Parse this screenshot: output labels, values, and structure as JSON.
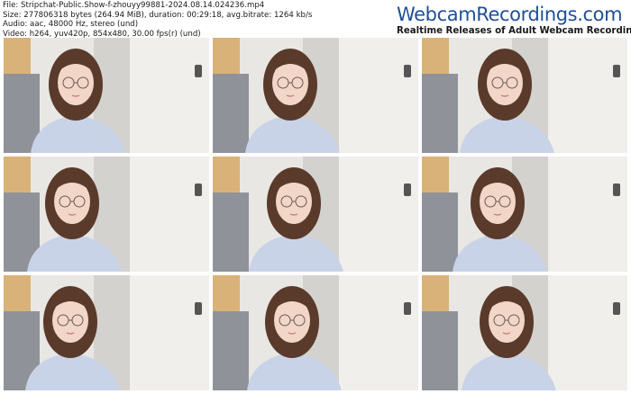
{
  "file_info": {
    "file": "File: Stripchat-Public.Show-f-zhouyy99881-2024.08.14.024236.mp4",
    "size": "Size: 277806318 bytes (264.94 MiB), duration: 00:29:18, avg.bitrate: 1264 kb/s",
    "audio": "Audio: aac, 48000 Hz, stereo (und)",
    "video": "Video: h264, yuv420p, 854x480, 30.00 fps(r) (und)"
  },
  "branding": {
    "site": "WebcamRecordings.com",
    "tagline": "Realtime Releases of Adult Webcam Recordings"
  },
  "colors": {
    "brand_blue": "#1f4e9a",
    "text_dark": "#1a1a1a",
    "wall": "#e9e7e4",
    "door": "#f1efec",
    "curtain": "#d9b27a",
    "shirt": "#c9d3e8",
    "hair": "#5a3a2a",
    "skin": "#f2d6c8"
  },
  "thumbnails": [
    {
      "name": "frame-1"
    },
    {
      "name": "frame-2"
    },
    {
      "name": "frame-3"
    },
    {
      "name": "frame-4"
    },
    {
      "name": "frame-5"
    },
    {
      "name": "frame-6"
    },
    {
      "name": "frame-7"
    },
    {
      "name": "frame-8"
    },
    {
      "name": "frame-9"
    }
  ]
}
